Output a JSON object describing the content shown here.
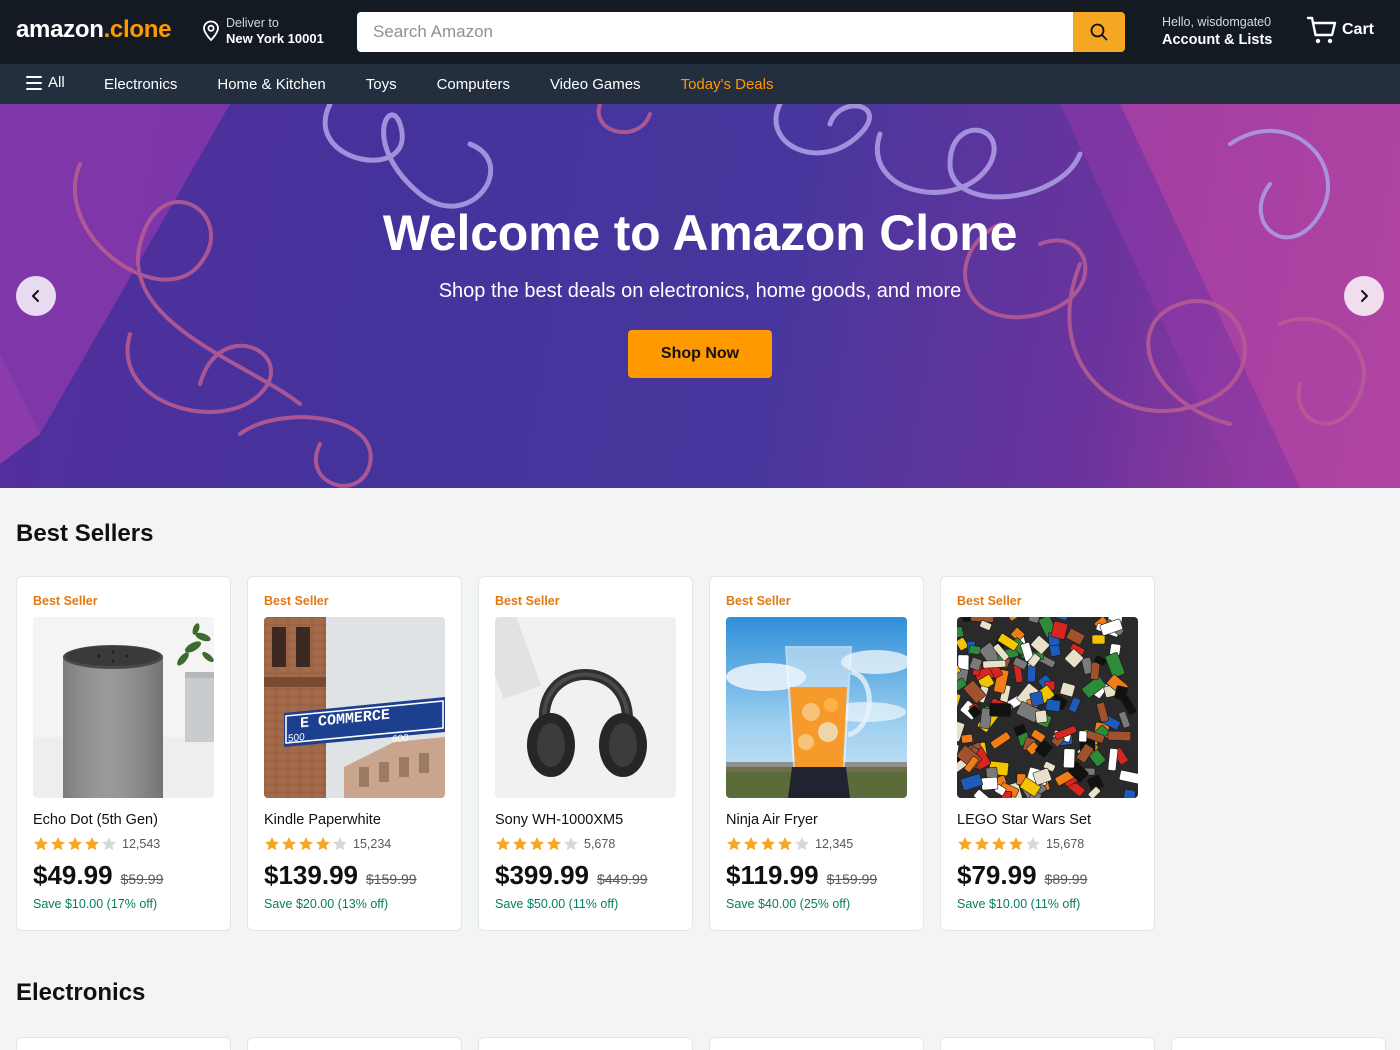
{
  "header": {
    "logo_main": "amazon",
    "logo_accent": ".clone",
    "deliver_line1": "Deliver to",
    "deliver_line2": "New York 10001",
    "search_placeholder": "Search Amazon",
    "account_line1": "Hello, wisdomgate0",
    "account_line2": "Account & Lists",
    "cart_label": "Cart"
  },
  "nav": {
    "all_label": "All",
    "links": [
      "Electronics",
      "Home & Kitchen",
      "Toys",
      "Computers",
      "Video Games",
      "Today's Deals"
    ]
  },
  "hero": {
    "title": "Welcome to Amazon Clone",
    "subtitle": "Shop the best deals on electronics, home goods, and more",
    "cta": "Shop Now"
  },
  "sections": {
    "best_sellers": {
      "title": "Best Sellers",
      "products": [
        {
          "badge": "Best Seller",
          "name": "Echo Dot (5th Gen)",
          "rating": 4,
          "reviews": "12,543",
          "price": "$49.99",
          "list_price": "$59.99",
          "savings": "Save $10.00 (17% off)"
        },
        {
          "badge": "Best Seller",
          "name": "Kindle Paperwhite",
          "rating": 4,
          "reviews": "15,234",
          "price": "$139.99",
          "list_price": "$159.99",
          "savings": "Save $20.00 (13% off)"
        },
        {
          "badge": "Best Seller",
          "name": "Sony WH-1000XM5",
          "rating": 4,
          "reviews": "5,678",
          "price": "$399.99",
          "list_price": "$449.99",
          "savings": "Save $50.00 (11% off)"
        },
        {
          "badge": "Best Seller",
          "name": "Ninja Air Fryer",
          "rating": 4,
          "reviews": "12,345",
          "price": "$119.99",
          "list_price": "$159.99",
          "savings": "Save $40.00 (25% off)"
        },
        {
          "badge": "Best Seller",
          "name": "LEGO Star Wars Set",
          "rating": 4,
          "reviews": "15,678",
          "price": "$79.99",
          "list_price": "$89.99",
          "savings": "Save $10.00 (11% off)"
        }
      ]
    },
    "electronics": {
      "title": "Electronics"
    }
  },
  "product_images": {
    "kindle_sign_text": "E COMMERCE",
    "kindle_sign_num_left": "500",
    "kindle_sign_num_right": "600"
  },
  "colors": {
    "header_bg": "#131a22",
    "nav_bg": "#232f3e",
    "accent": "#ff9900",
    "deal_link": "#ff9900",
    "badge": "#e47911",
    "savings": "#067d62",
    "star_filled": "#f5a623",
    "star_empty": "#d5d9d9"
  },
  "icons": {
    "location": "location-pin-icon",
    "search": "search-icon",
    "cart": "cart-icon",
    "menu": "hamburger-menu-icon",
    "prev": "chevron-left-icon",
    "next": "chevron-right-icon",
    "star": "star-icon"
  }
}
